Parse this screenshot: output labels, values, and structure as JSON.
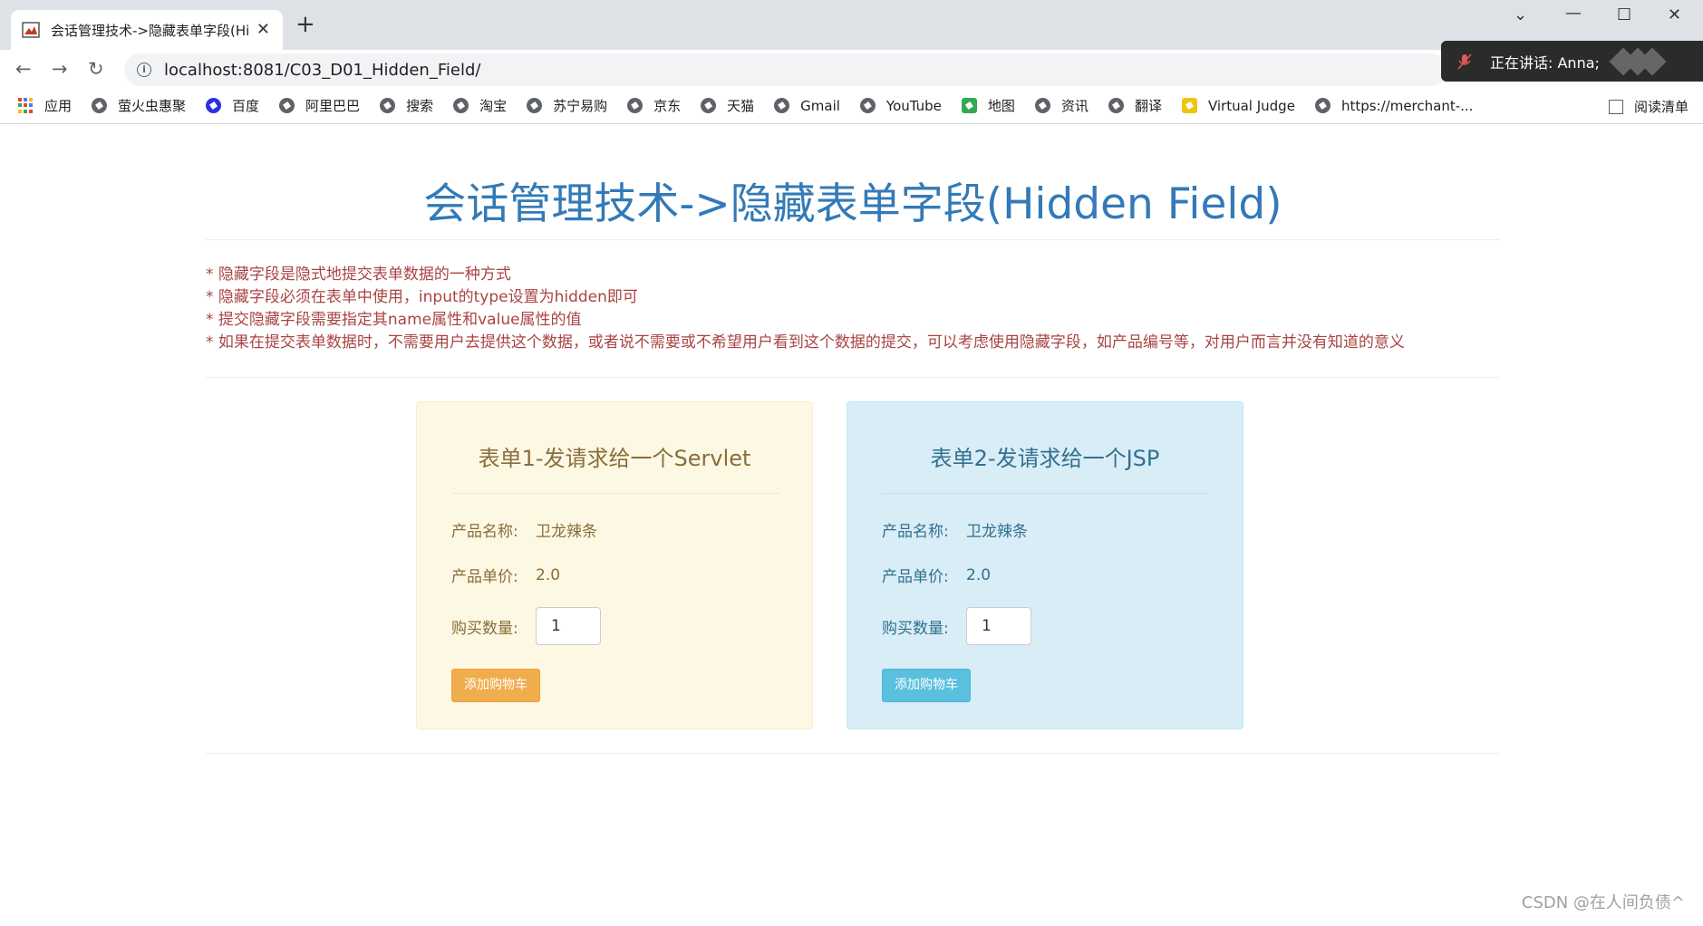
{
  "browser": {
    "tab_title": "会话管理技术->隐藏表单字段(Hi",
    "url": "localhost:8081/C03_D01_Hidden_Field/",
    "speaking_banner": "正在讲话: Anna;",
    "bookmarks": [
      {
        "label": "应用",
        "icon": "apps-icon"
      },
      {
        "label": "萤火虫惠聚",
        "icon": "globe-icon"
      },
      {
        "label": "百度",
        "icon": "baidu-icon"
      },
      {
        "label": "阿里巴巴",
        "icon": "globe-icon"
      },
      {
        "label": "搜索",
        "icon": "globe-icon"
      },
      {
        "label": "淘宝",
        "icon": "globe-icon"
      },
      {
        "label": "苏宁易购",
        "icon": "globe-icon"
      },
      {
        "label": "京东",
        "icon": "globe-icon"
      },
      {
        "label": "天猫",
        "icon": "globe-icon"
      },
      {
        "label": "Gmail",
        "icon": "globe-icon"
      },
      {
        "label": "YouTube",
        "icon": "globe-icon"
      },
      {
        "label": "地图",
        "icon": "maps-icon"
      },
      {
        "label": "资讯",
        "icon": "globe-icon"
      },
      {
        "label": "翻译",
        "icon": "globe-icon"
      },
      {
        "label": "Virtual Judge",
        "icon": "vjudge-icon"
      },
      {
        "label": "https://merchant-...",
        "icon": "globe-icon"
      }
    ],
    "reading_list": "阅读清单"
  },
  "page": {
    "title": "会话管理技术->隐藏表单字段(Hidden Field)",
    "notes": [
      "* 隐藏字段是隐式地提交表单数据的一种方式",
      "* 隐藏字段必须在表单中使用，input的type设置为hidden即可",
      "* 提交隐藏字段需要指定其name属性和value属性的值",
      "* 如果在提交表单数据时，不需要用户去提供这个数据，或者说不需要或不希望用户看到这个数据的提交，可以考虑使用隐藏字段，如产品编号等，对用户而言并没有知道的意义"
    ],
    "forms": [
      {
        "title": "表单1-发请求给一个Servlet",
        "name_label": "产品名称:",
        "name_value": "卫龙辣条",
        "price_label": "产品单价:",
        "price_value": "2.0",
        "qty_label": "购买数量:",
        "qty_value": "1",
        "button": "添加购物车"
      },
      {
        "title": "表单2-发请求给一个JSP",
        "name_label": "产品名称:",
        "name_value": "卫龙辣条",
        "price_label": "产品单价:",
        "price_value": "2.0",
        "qty_label": "购买数量:",
        "qty_value": "1",
        "button": "添加购物车"
      }
    ]
  },
  "watermark": "CSDN @在人间负债^",
  "colors": {
    "title": "#337ab7",
    "notes": "#a94442",
    "warning_panel": "#fcf8e3",
    "info_panel": "#d9edf7",
    "warning_button": "#f0ad4e",
    "info_button": "#5bc0de"
  }
}
